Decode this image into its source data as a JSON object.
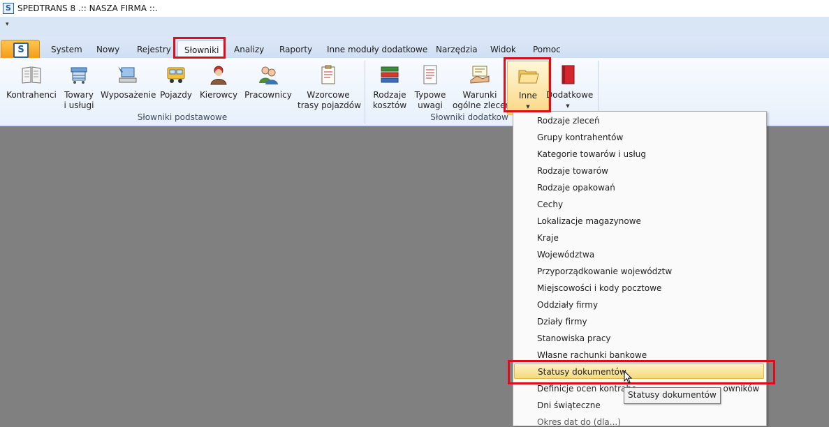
{
  "window": {
    "title": "SPEDTRANS 8 .:: NASZA FIRMA ::."
  },
  "app_logo": "S",
  "qat": {
    "arrow": "▾"
  },
  "tabs": [
    {
      "label": "System"
    },
    {
      "label": "Nowy"
    },
    {
      "label": "Rejestry"
    },
    {
      "label": "Słowniki",
      "active": true
    },
    {
      "label": "Analizy"
    },
    {
      "label": "Raporty"
    },
    {
      "label": "Inne moduły dodatkowe"
    },
    {
      "label": "Narzędzia"
    },
    {
      "label": "Widok"
    },
    {
      "label": "Pomoc"
    }
  ],
  "ribbon": {
    "groups": [
      {
        "label": "Słowniki podstawowe",
        "buttons": [
          {
            "label": "Kontrahenci",
            "icon": "book-icon"
          },
          {
            "label": "Towary\ni usługi",
            "icon": "goods-icon"
          },
          {
            "label": "Wyposażenie",
            "icon": "equipment-icon"
          },
          {
            "label": "Pojazdy",
            "icon": "truck-icon"
          },
          {
            "label": "Kierowcy",
            "icon": "driver-icon"
          },
          {
            "label": "Pracownicy",
            "icon": "employees-icon"
          },
          {
            "label": "Wzorcowe\ntrasy pojazdów",
            "icon": "route-clipboard-icon"
          }
        ]
      },
      {
        "label": "Słowniki dodatkow",
        "buttons": [
          {
            "label": "Rodzaje\nkosztów",
            "icon": "cost-types-icon"
          },
          {
            "label": "Typowe\nuwagi",
            "icon": "notes-icon"
          },
          {
            "label": "Warunki\nogólne zlecer",
            "icon": "handshake-icon"
          },
          {
            "label": "Inne",
            "icon": "folder-icon",
            "dropdown": true,
            "active": true
          },
          {
            "label": "Dodatkowe",
            "icon": "red-book-icon",
            "dropdown": true
          }
        ]
      }
    ]
  },
  "menu": {
    "items": [
      "Rodzaje zleceń",
      "Grupy kontrahentów",
      "Kategorie towarów i usług",
      "Rodzaje towarów",
      "Rodzaje opakowań",
      "Cechy",
      "Lokalizacje magazynowe",
      "Kraje",
      "Województwa",
      "Przyporządkowanie województw",
      "Miejscowości i kody pocztowe",
      "Oddziały firmy",
      "Działy firmy",
      "Stanowiska pracy",
      "Własne rachunki bankowe",
      "Statusy dokumentów",
      "Definicje ocen kontrahe",
      "Dni świąteczne",
      "Okres dat do (dla...)"
    ],
    "item_16_suffix": "owników",
    "highlighted_index": 15
  },
  "tooltip": {
    "text": "Statusy dokumentów"
  },
  "colors": {
    "highlight_border": "#e20b1a",
    "ribbon_bg": "#e7f0fb",
    "workspace": "#808080"
  }
}
